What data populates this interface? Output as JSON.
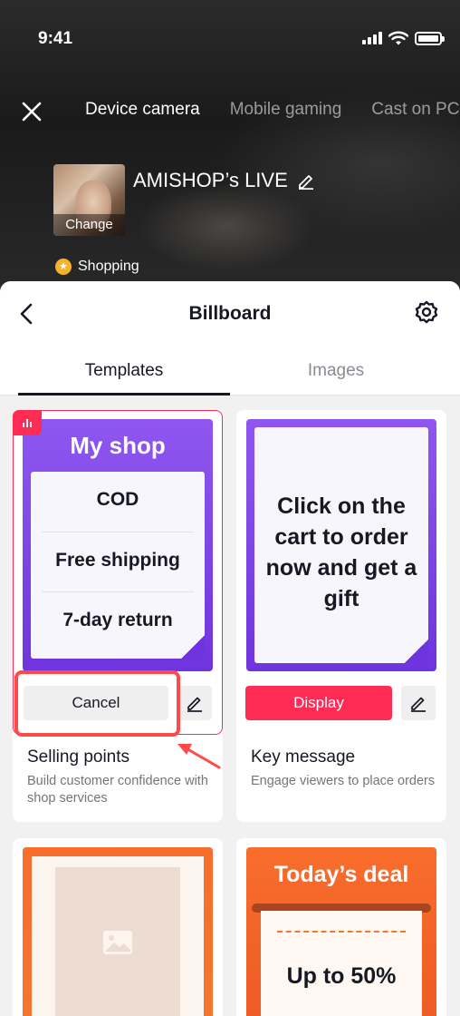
{
  "status_bar": {
    "time": "9:41"
  },
  "top_nav": {
    "tabs": [
      {
        "label": "Device camera",
        "active": true
      },
      {
        "label": "Mobile gaming",
        "active": false
      },
      {
        "label": "Cast on PC",
        "active": false
      }
    ]
  },
  "live": {
    "cover_change_label": "Change",
    "title": "AMISHOP’s LIVE",
    "shopping_label": "Shopping"
  },
  "sheet": {
    "title": "Billboard",
    "tabs": [
      {
        "label": "Templates",
        "active": true
      },
      {
        "label": "Images",
        "active": false
      }
    ]
  },
  "templates": [
    {
      "preview_title": "My shop",
      "points": [
        "COD",
        "Free shipping",
        "7-day return"
      ],
      "action_label": "Cancel",
      "selected": true,
      "name": "Selling points",
      "description": "Build customer confidence with shop services"
    },
    {
      "preview_text": "Click on the cart to order now and get a gift",
      "action_label": "Display",
      "selected": false,
      "name": "Key message",
      "description": "Engage viewers to place orders"
    },
    {
      "preview_type": "image"
    },
    {
      "preview_title": "Today’s deal",
      "preview_text": "Up to 50%"
    }
  ],
  "colors": {
    "accent": "#fe2c55",
    "purple": "#7b3fe4",
    "orange": "#f4762f",
    "annotation": "#ff4a4a"
  }
}
